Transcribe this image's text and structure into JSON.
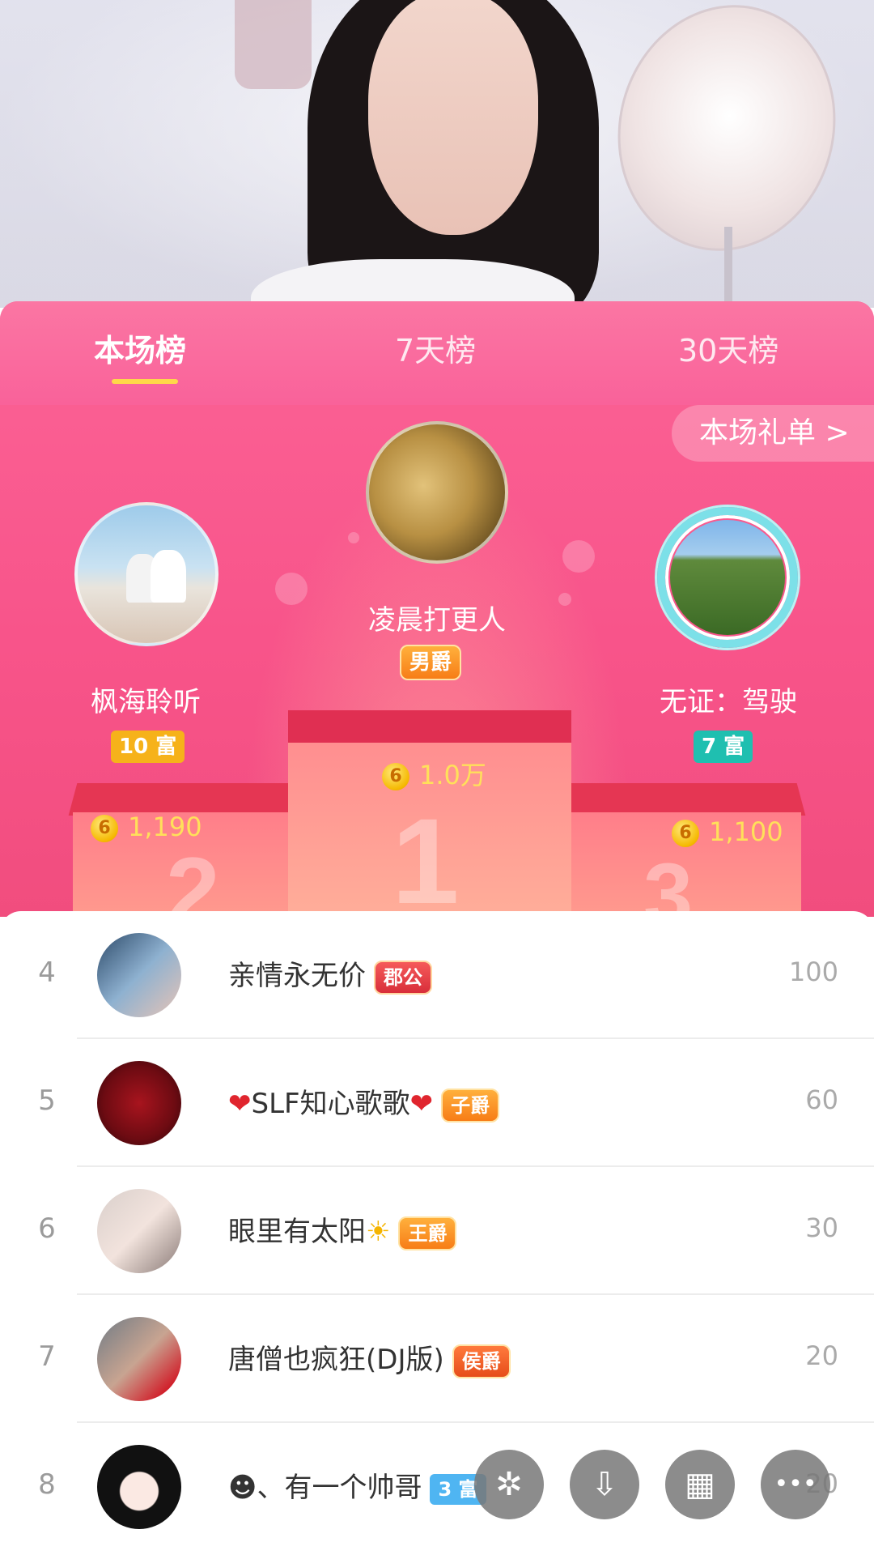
{
  "tabs": [
    {
      "label": "本场榜",
      "active": true
    },
    {
      "label": "7天榜",
      "active": false
    },
    {
      "label": "30天榜",
      "active": false
    }
  ],
  "gift_list_button": "本场礼单 >",
  "top3": [
    {
      "rank": 1,
      "name": "凌晨打更人",
      "badge": "男爵",
      "score": "1.0万",
      "avatar": "gong"
    },
    {
      "rank": 2,
      "name": "枫海聆听",
      "badge": "10 富",
      "score": "1,190",
      "avatar": "beach-couple"
    },
    {
      "rank": 3,
      "name": "无证：驾驶",
      "badge": "7 富",
      "score": "1,100",
      "avatar": "green-field"
    }
  ],
  "podium_numbers": [
    "1",
    "2",
    "3"
  ],
  "coin_glyph": "6",
  "list": [
    {
      "rank": "4",
      "name": "亲情永无价",
      "badge": "郡公",
      "value": "100"
    },
    {
      "rank": "5",
      "name_prefix": "❤",
      "name": "SLF知心歌歌",
      "name_suffix": "❤",
      "badge": "子爵",
      "value": "60"
    },
    {
      "rank": "6",
      "name": "眼里有太阳",
      "name_suffix": "☀",
      "badge": "王爵",
      "value": "30"
    },
    {
      "rank": "7",
      "name": "唐僧也疯狂(DJ版)",
      "badge": "侯爵",
      "value": "20"
    },
    {
      "rank": "8",
      "name": "☻、有一个帅哥",
      "badge": "3 富",
      "value": "20"
    }
  ],
  "fabs": [
    {
      "icon": "sparkle-icon",
      "glyph": "✲"
    },
    {
      "icon": "download-icon",
      "glyph": "⇩"
    },
    {
      "icon": "grid-icon",
      "glyph": "▦"
    },
    {
      "icon": "more-icon",
      "glyph": "•••"
    }
  ],
  "colors": {
    "panel_pink": "#f8548a",
    "tab_underline": "#ffd84a",
    "score_yellow": "#ffe05a"
  }
}
